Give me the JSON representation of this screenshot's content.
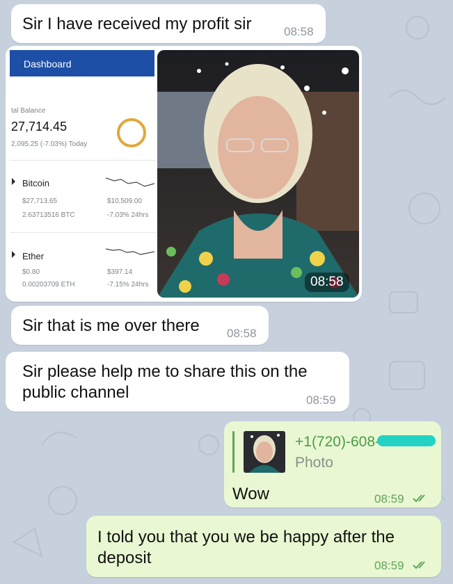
{
  "messages": [
    {
      "text": "Sir I have received my profit sir",
      "time": "08:58"
    },
    {
      "text": "Sir that is me over there",
      "time": "08:58"
    },
    {
      "text_line1": "Sir please help me to share this on the",
      "text_line2": "public channel",
      "time": "08:59"
    }
  ],
  "media": {
    "time": "08:58",
    "screenshot": {
      "header": "Dashboard",
      "balance_label": "tal Balance",
      "balance": "27,714.45",
      "balance_change": "2,095.25 (-7.03%) Today",
      "assets": [
        {
          "name": "Bitcoin",
          "price": "$27,713.65",
          "amount": "2.63713516 BTC",
          "value": "$10,509.00",
          "change": "-7.03% 24hrs"
        },
        {
          "name": "Ether",
          "price": "$0.80",
          "amount": "0.00203709 ETH",
          "value": "$397.14",
          "change": "-7.15% 24hrs"
        }
      ]
    }
  },
  "outgoing": [
    {
      "reply_name": "+1(720)-608-",
      "reply_type": "Photo",
      "text": "Wow",
      "time": "08:59"
    },
    {
      "text_line1": "I told you that you we be happy after the",
      "text_line2": "deposit",
      "time": "08:59"
    }
  ],
  "colors": {
    "incoming": "#ffffff",
    "outgoing": "#e9f8d2",
    "accent": "#5fa55a",
    "background": "#c7d1dd"
  }
}
